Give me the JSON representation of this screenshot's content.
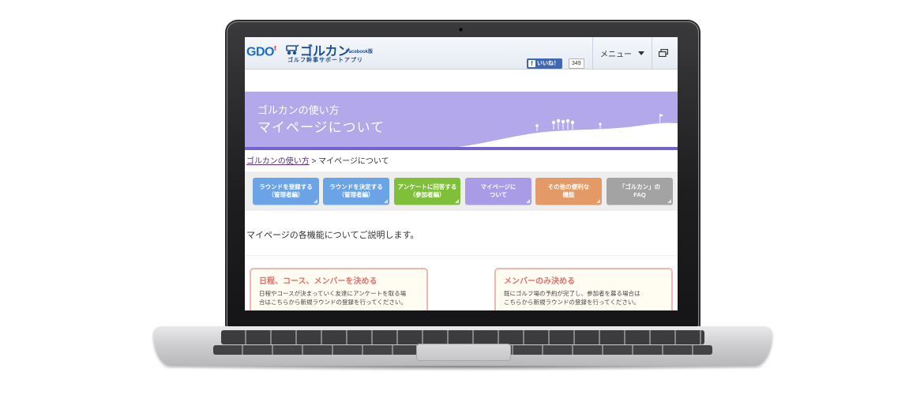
{
  "header": {
    "logo": "GDO",
    "logo_mark": "f",
    "app_name": "ゴルカン",
    "edition": "Facebook版",
    "tagline": "ゴルフ幹事サポートアプリ",
    "like_label": "いいね！",
    "like_count": "349",
    "menu_label": "メニュー",
    "icons": [
      "golf-cart-icon",
      "facebook-icon",
      "chevron-down-icon",
      "window-icon"
    ]
  },
  "banner": {
    "subtitle": "ゴルカンの使い方",
    "title": "マイページについて"
  },
  "breadcrumb": {
    "link": "ゴルカンの使い方",
    "separator": " > ",
    "current": "マイページについて"
  },
  "nav": [
    {
      "line1": "ラウンドを登録する",
      "line2": "（管理者編）",
      "color": "#6aa3e6"
    },
    {
      "line1": "ラウンドを決定する",
      "line2": "（管理者編）",
      "color": "#6aa3e6"
    },
    {
      "line1": "アンケートに回答する",
      "line2": "（参加者編）",
      "color": "#7fbf3a"
    },
    {
      "line1": "マイページに",
      "line2": "ついて",
      "color": "#a99be6"
    },
    {
      "line1": "その他の便利な",
      "line2": "機能",
      "color": "#e49a66"
    },
    {
      "line1": "「ゴルカン」の",
      "line2": "FAQ",
      "color": "#a3a3a3"
    }
  ],
  "intro": "マイページの各機能についてご説明します。",
  "cards": [
    {
      "title": "日程、コース、メンバーを決める",
      "line1": "日程やコースが決まっていく友達にアンケートを取る場",
      "line2": "合はこちらから新規ラウンドの登録を行ってください。"
    },
    {
      "title": "メンバーのみ決める",
      "line1": "既にゴルフ場の予約が完了し、参加者を募る場合は",
      "line2": "こちらから新規ラウンドの登録を行ってください。"
    }
  ],
  "colors": {
    "banner": "#b3a9ea",
    "banner_border": "#7463cf",
    "card_border": "#f3b5b2",
    "card_title": "#e46f6a",
    "brand_blue": "#1d4f93"
  }
}
